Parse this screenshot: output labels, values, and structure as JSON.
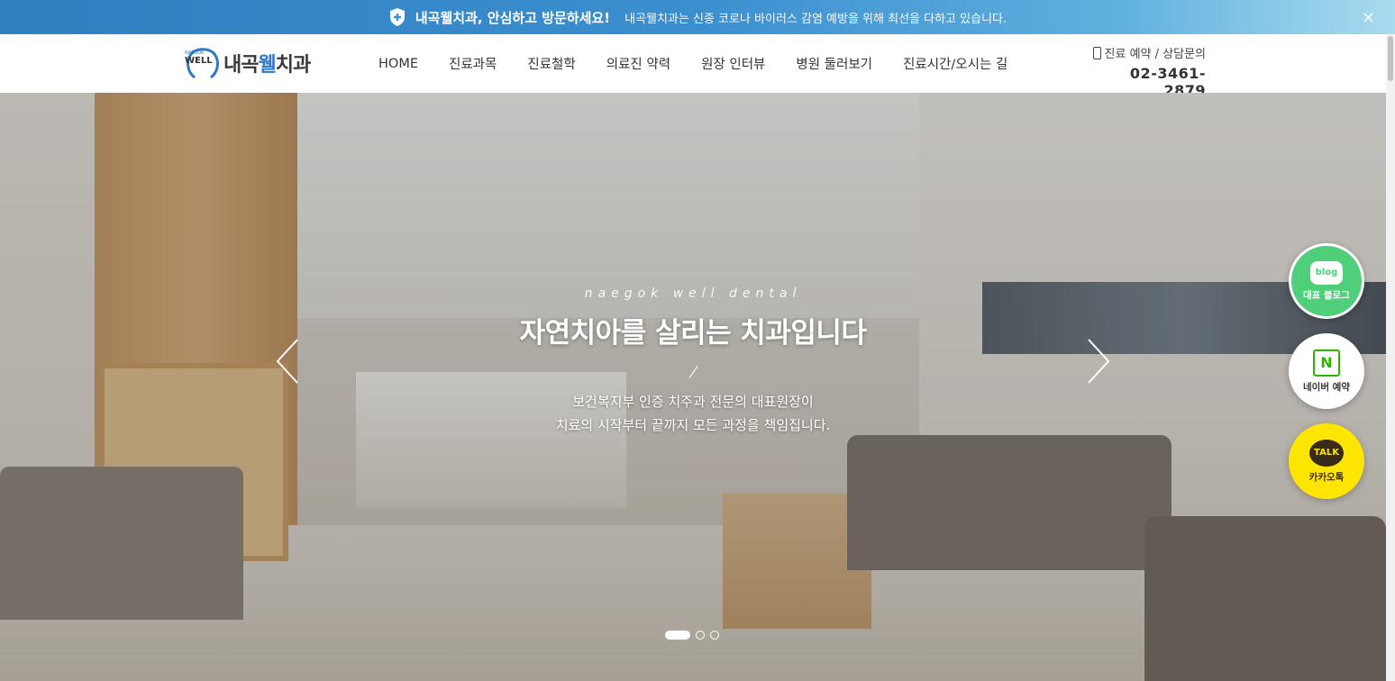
{
  "notice": {
    "title": "내곡웰치과, 안심하고 방문하세요!",
    "message": "내곡웰치과는 신종 코로나 바이러스 감염 예방을 위해 최선을 다하고 있습니다.",
    "close_label": "×"
  },
  "logo": {
    "mark_small": "NAEGOK",
    "mark_well": "WELL",
    "name_prefix": "내곡",
    "name_accent": "웰",
    "name_suffix": "치과"
  },
  "nav": {
    "items": [
      "HOME",
      "진료과목",
      "진료철학",
      "의료진 약력",
      "원장 인터뷰",
      "병원 둘러보기",
      "진료시간/오시는 길"
    ]
  },
  "contact": {
    "label": "진료 예약 / 상담문의",
    "phone": "02-3461-2879"
  },
  "hero": {
    "eyebrow": "naegok well dental",
    "headline": "자연치아를 살리는 치과입니다",
    "desc_line1": "보건복지부 인증 치주과 전문의 대표원장이",
    "desc_line2": "치료의 시작부터 끝까지 모든 과정을 책임집니다.",
    "slide_count": 3,
    "active_slide": 1
  },
  "quick_menu": {
    "blog_icon": "blog",
    "blog_label": "대표 블로그",
    "naver_icon": "N",
    "naver_label": "네이버 예약",
    "kakao_icon": "TALK",
    "kakao_label": "카카오톡"
  },
  "colors": {
    "brand_blue": "#2e78c6",
    "blog_green": "#4fcf7a",
    "naver_green": "#2db400",
    "kakao_yellow": "#fde500"
  }
}
